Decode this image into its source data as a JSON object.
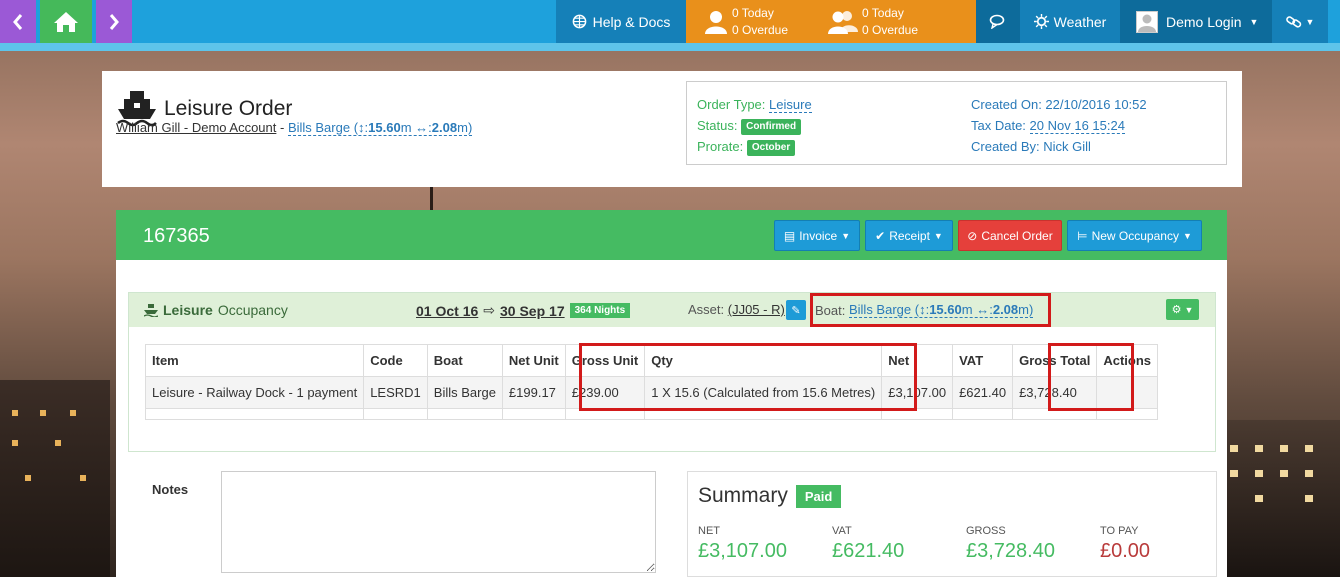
{
  "nav": {
    "help_label": "Help & Docs",
    "today_1": "0 Today",
    "overdue_1": "0 Overdue",
    "today_2": "0 Today",
    "overdue_2": "0 Overdue",
    "weather_label": "Weather",
    "user_label": "Demo Login"
  },
  "header": {
    "title": "Leisure Order",
    "customer": "William Gill - Demo Account",
    "separator": " - ",
    "boat_name": "Bills Barge",
    "boat_length": "15.60",
    "boat_width": "2.08",
    "unit_m": "m",
    "order_type_label": "Order Type:",
    "order_type": "Leisure",
    "status_label": "Status:",
    "status": "Confirmed",
    "prorate_label": "Prorate:",
    "prorate": "October",
    "created_on": "Created On: 22/10/2016 10:52",
    "tax_date_label": "Tax Date:",
    "tax_date": "20 Nov 16 15:24",
    "created_by": "Created By: Nick Gill"
  },
  "order": {
    "number": "167365",
    "buttons": {
      "invoice": "Invoice",
      "receipt": "Receipt",
      "cancel": "Cancel Order",
      "new_occupancy": "New Occupancy"
    }
  },
  "occupancy": {
    "type": "Leisure",
    "label": "Occupancy",
    "start": "01 Oct 16",
    "end": "30 Sep 17",
    "nights": "364 Nights",
    "asset_label": "Asset:",
    "asset": "(JJ05 - R)",
    "boat_label": "Boat:",
    "boat_name": "Bills Barge",
    "boat_length": "15.60",
    "boat_width": "2.08"
  },
  "table": {
    "headers": [
      "Item",
      "Code",
      "Boat",
      "Net Unit",
      "Gross Unit",
      "Qty",
      "Net",
      "VAT",
      "Gross Total",
      "Actions"
    ],
    "rows": [
      [
        "Leisure - Railway Dock - 1 payment",
        "LESRD1",
        "Bills Barge",
        "£199.17",
        "£239.00",
        "1 X 15.6 (Calculated from 15.6 Metres)",
        "£3,107.00",
        "£621.40",
        "£3,728.40",
        ""
      ]
    ]
  },
  "notes": {
    "label": "Notes"
  },
  "summary": {
    "title": "Summary",
    "badge": "Paid",
    "net_label": "NET",
    "net": "£3,107.00",
    "vat_label": "VAT",
    "vat": "£621.40",
    "gross_label": "GROSS",
    "gross": "£3,728.40",
    "topay_label": "TO PAY",
    "topay": "£0.00"
  }
}
